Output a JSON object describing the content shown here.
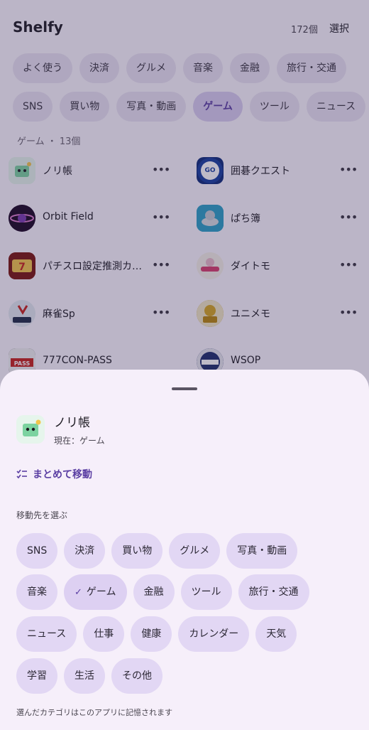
{
  "header": {
    "title": "Shelfy",
    "count": "172個",
    "select_label": "選択"
  },
  "category_rows": [
    [
      {
        "label": "よく使う"
      },
      {
        "label": "決済"
      },
      {
        "label": "グルメ"
      },
      {
        "label": "音楽"
      },
      {
        "label": "金融"
      },
      {
        "label": "旅行・交通"
      }
    ],
    [
      {
        "label": "SNS"
      },
      {
        "label": "買い物"
      },
      {
        "label": "写真・動画"
      },
      {
        "label": "ゲーム",
        "active": true
      },
      {
        "label": "ツール"
      },
      {
        "label": "ニュース"
      }
    ]
  ],
  "section": {
    "label": "ゲーム ・ 13個"
  },
  "apps": [
    {
      "name": "ノリ帳",
      "icon": "nori-cho-icon",
      "color": "#dff3e6"
    },
    {
      "name": "囲碁クエスト",
      "icon": "go-quest-icon",
      "color": "#0d2a7a"
    },
    {
      "name": "Orbit Field",
      "icon": "orbit-field-icon",
      "color": "#2b0a36"
    },
    {
      "name": "ぱち簿",
      "icon": "pachibo-icon",
      "color": "#1f8fb4"
    },
    {
      "name": "パチスロ設定推測カ…",
      "icon": "pachislot-icon",
      "color": "#8a1a12"
    },
    {
      "name": "ダイトモ",
      "icon": "daitomo-icon",
      "color": "#f4efe6"
    },
    {
      "name": "麻雀Sp",
      "icon": "mahjong-sp-icon",
      "color": "#e9edf3"
    },
    {
      "name": "ユニメモ",
      "icon": "unimemo-icon",
      "color": "#c9a227"
    },
    {
      "name": "777CON-PASS",
      "icon": "con-pass-icon",
      "color": "#2a2a2a"
    },
    {
      "name": "WSOP",
      "icon": "wsop-icon",
      "color": "#1d2d6b"
    }
  ],
  "sheet": {
    "app_name": "ノリ帳",
    "current": "現在：ゲーム",
    "bulk_move": "まとめて移動",
    "dest_label": "移動先を選ぶ",
    "dest_rows": [
      [
        {
          "label": "SNS"
        },
        {
          "label": "決済"
        },
        {
          "label": "買い物"
        },
        {
          "label": "グルメ"
        },
        {
          "label": "写真・動画"
        }
      ],
      [
        {
          "label": "音楽"
        },
        {
          "label": "ゲーム",
          "selected": true
        },
        {
          "label": "金融"
        },
        {
          "label": "ツール"
        },
        {
          "label": "旅行・交通"
        }
      ],
      [
        {
          "label": "ニュース"
        },
        {
          "label": "仕事"
        },
        {
          "label": "健康"
        },
        {
          "label": "カレンダー"
        },
        {
          "label": "天気"
        }
      ],
      [
        {
          "label": "学習"
        },
        {
          "label": "生活"
        },
        {
          "label": "その他"
        }
      ]
    ],
    "footnote": "選んだカテゴリはこのアプリに記憶されます"
  },
  "colors": {
    "accent": "#5b3fa3",
    "chip": "#e2d7f4",
    "sheet": "#f6effa"
  }
}
